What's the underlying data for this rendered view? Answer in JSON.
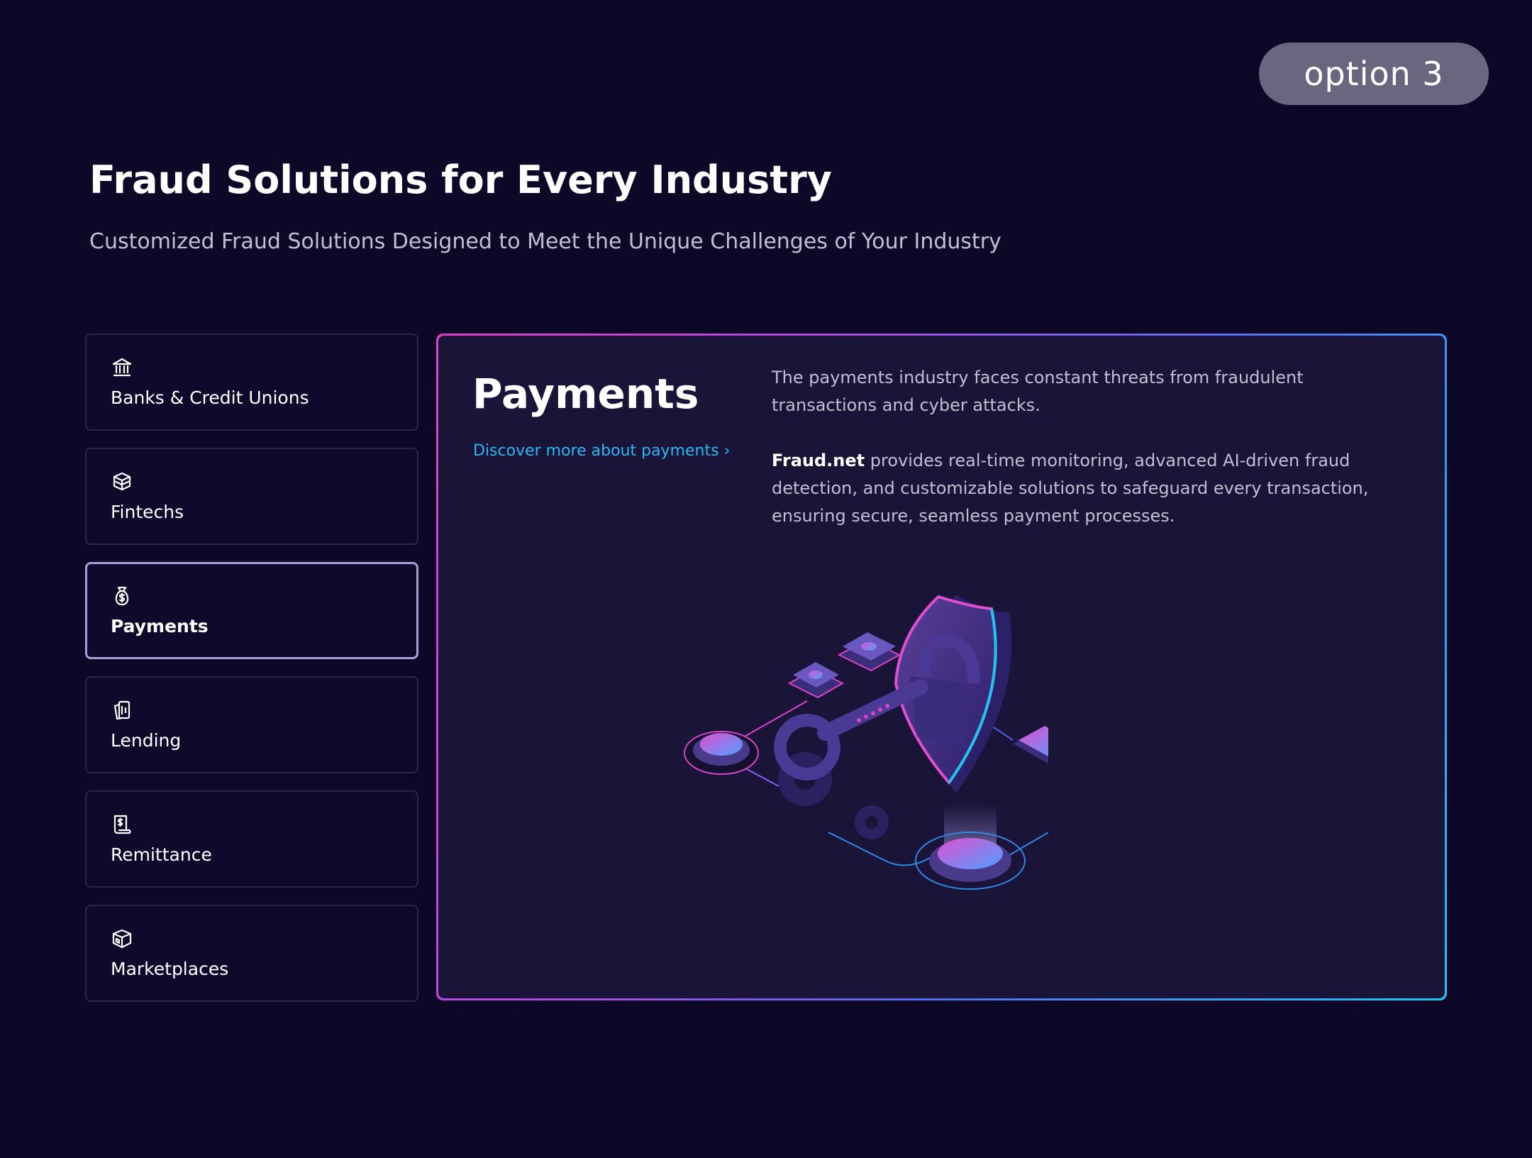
{
  "badge": {
    "label": "option 3"
  },
  "header": {
    "title": "Fraud Solutions for Every Industry",
    "subtitle": "Customized Fraud Solutions Designed to Meet the Unique Challenges of Your Industry"
  },
  "sidebar": {
    "items": [
      {
        "label": "Banks & Credit Unions",
        "icon": "bank-icon",
        "active": false
      },
      {
        "label": "Fintechs",
        "icon": "stacked-box-icon",
        "active": false
      },
      {
        "label": "Payments",
        "icon": "money-bag-icon",
        "active": true
      },
      {
        "label": "Lending",
        "icon": "cards-icon",
        "active": false
      },
      {
        "label": "Remittance",
        "icon": "receipt-icon",
        "active": false
      },
      {
        "label": "Marketplaces",
        "icon": "package-icon",
        "active": false
      }
    ]
  },
  "panel": {
    "title": "Payments",
    "link_label": "Discover more about payments ›",
    "paragraph1": "The payments industry faces constant threats from fraudulent transactions and cyber attacks.",
    "brand": "Fraud.net",
    "paragraph2_rest": " provides real-time monitoring, advanced AI-driven fraud detection, and customizable solutions to safeguard every transaction, ensuring secure, seamless payment processes.",
    "illustration": "shield-lock-key-illustration"
  },
  "colors": {
    "background": "#0e0828",
    "panel_background": "#1a1438",
    "accent_link": "#29b8f2",
    "border_gradient_start": "#e03fc7",
    "border_gradient_end": "#1fc3f0",
    "active_border": "#a99ed8"
  }
}
